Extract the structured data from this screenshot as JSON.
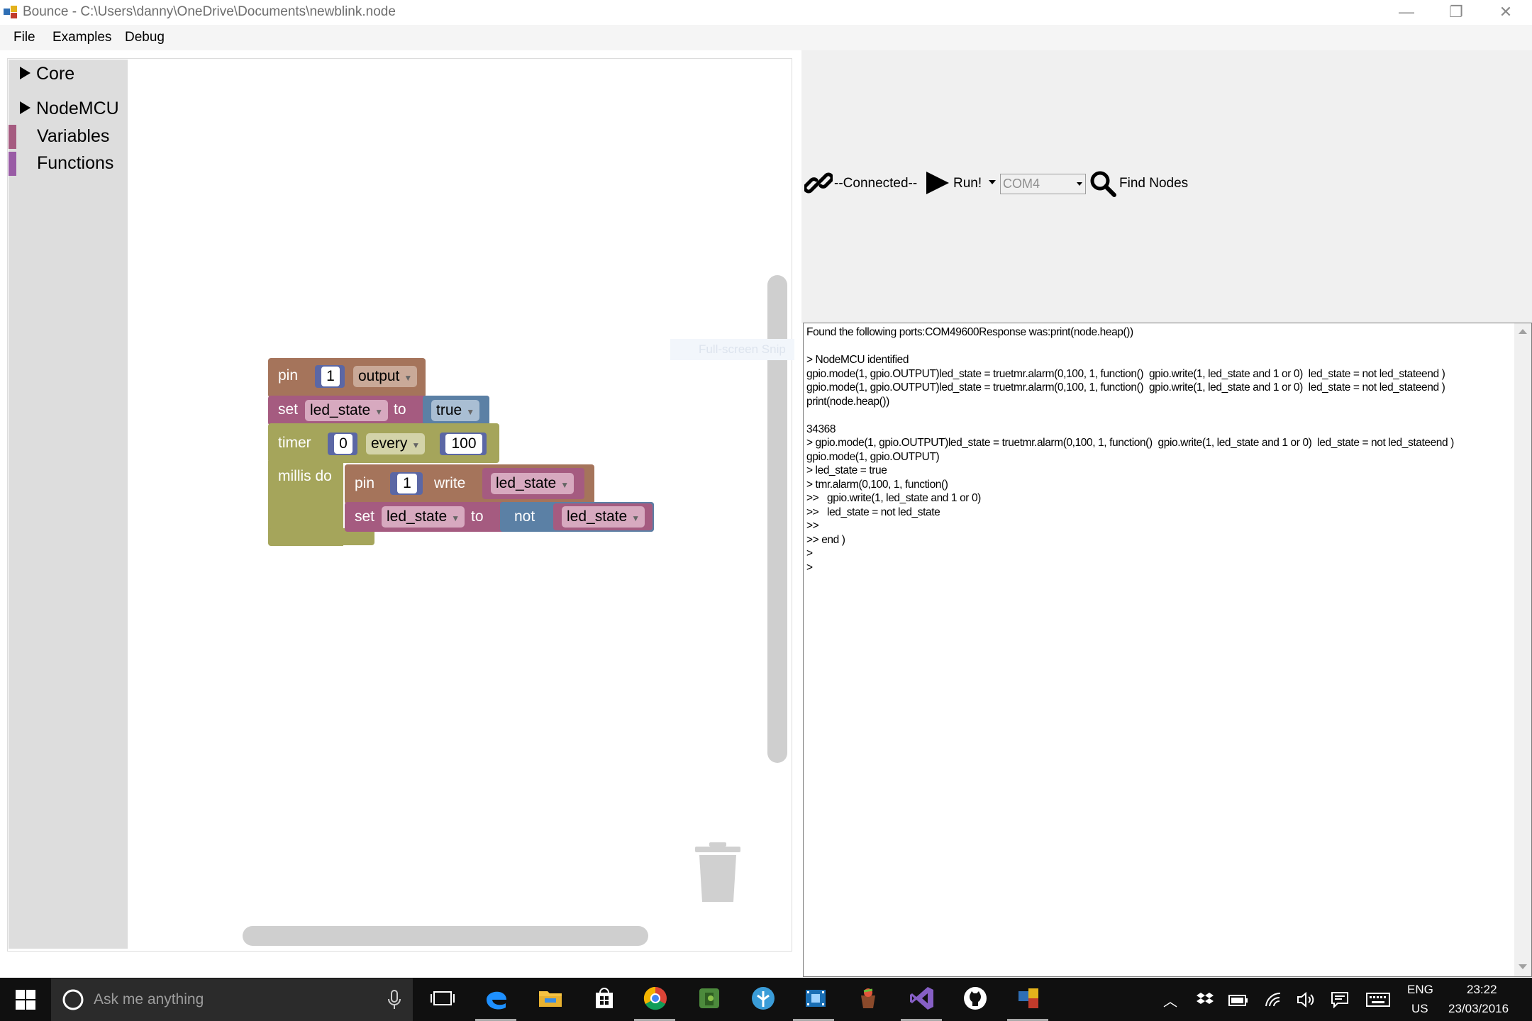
{
  "window": {
    "title": "Bounce - C:\\Users\\danny\\OneDrive\\Documents\\newblink.node",
    "minimize_glyph": "—",
    "restore_glyph": "❐",
    "close_glyph": "✕"
  },
  "menu": {
    "items": [
      {
        "label": "File"
      },
      {
        "label": "Examples"
      },
      {
        "label": "Debug"
      }
    ]
  },
  "toolbox": {
    "items": [
      {
        "label": "Core",
        "kind": "category-collapsed"
      },
      {
        "label": "NodeMCU",
        "kind": "category-collapsed"
      },
      {
        "label": "Variables",
        "kind": "category",
        "color": "#a55b80"
      },
      {
        "label": "Functions",
        "kind": "category",
        "color": "#995ba5"
      }
    ]
  },
  "workspace": {
    "ghost_text": "Full-screen Snip",
    "blocks": {
      "pin_mode": {
        "keyword": "pin",
        "pin": "1",
        "mode": "output",
        "color": "#a5745b"
      },
      "set_var": {
        "keyword": "set",
        "variable": "led_state",
        "to": "to",
        "value": "true",
        "color": "#a55b80",
        "value_color": "#5b80a5"
      },
      "timer": {
        "keyword": "timer",
        "timer_id": "0",
        "repeat": "every",
        "interval": "100",
        "body_label": "millis do",
        "color": "#a5a55b"
      },
      "pin_write": {
        "keyword": "pin",
        "pin": "1",
        "action": "write",
        "variable": "led_state",
        "color": "#a5745b"
      },
      "set_not": {
        "keyword": "set",
        "variable": "led_state",
        "to": "to",
        "op": "not",
        "operand": "led_state",
        "color": "#a55b80",
        "op_color": "#5b80a5"
      }
    }
  },
  "connection": {
    "status": "--Connected--",
    "run_label": "Run!",
    "port": "COM4",
    "find_label": "Find Nodes"
  },
  "console": {
    "lines": [
      "Found the following ports:COM49600Response was:print(node.heap())",
      "",
      "> NodeMCU identified",
      "gpio.mode(1, gpio.OUTPUT)led_state = truetmr.alarm(0,100, 1, function()  gpio.write(1, led_state and 1 or 0)  led_state = not led_stateend )",
      "gpio.mode(1, gpio.OUTPUT)led_state = truetmr.alarm(0,100, 1, function()  gpio.write(1, led_state and 1 or 0)  led_state = not led_stateend )",
      "print(node.heap())",
      "",
      "34368",
      "> gpio.mode(1, gpio.OUTPUT)led_state = truetmr.alarm(0,100, 1, function()  gpio.write(1, led_state and 1 or 0)  led_state = not led_stateend )",
      "gpio.mode(1, gpio.OUTPUT)",
      "> led_state = true",
      "> tmr.alarm(0,100, 1, function()",
      ">>   gpio.write(1, led_state and 1 or 0)",
      ">>   led_state = not led_state",
      ">>",
      ">> end )",
      ">",
      ">"
    ]
  },
  "taskbar": {
    "search_placeholder": "Ask me anything",
    "language": "ENG",
    "region": "US",
    "time": "23:22",
    "date": "23/03/2016",
    "apps": [
      "task-view-icon",
      "edge-icon",
      "file-explorer-icon",
      "store-icon",
      "chrome-icon",
      "evernote-icon",
      "app-tree-icon",
      "movie-maker-icon",
      "chocolatey-icon",
      "visual-studio-icon",
      "github-icon",
      "bounce-app-icon"
    ]
  }
}
